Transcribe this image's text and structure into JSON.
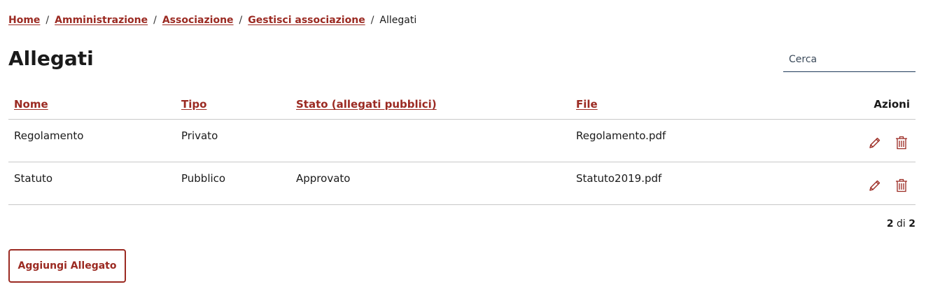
{
  "breadcrumb": {
    "items": [
      "Home",
      "Amministrazione",
      "Associazione",
      "Gestisci associazione"
    ],
    "separator": "/",
    "current": "Allegati"
  },
  "page": {
    "title": "Allegati"
  },
  "search": {
    "placeholder": "Cerca",
    "value": ""
  },
  "table": {
    "headers": {
      "nome": "Nome",
      "tipo": "Tipo",
      "stato": "Stato (allegati pubblici)",
      "file": "File",
      "azioni": "Azioni"
    },
    "rows": [
      {
        "nome": "Regolamento",
        "tipo": "Privato",
        "stato": "",
        "file": "Regolamento.pdf"
      },
      {
        "nome": "Statuto",
        "tipo": "Pubblico",
        "stato": "Approvato",
        "file": "Statuto2019.pdf"
      }
    ]
  },
  "pagination": {
    "current": "2",
    "sep": "di",
    "total": "2"
  },
  "actions": {
    "add_label": "Aggiungi Allegato"
  },
  "icons": {
    "edit": "pencil-icon",
    "delete": "trash-icon"
  },
  "colors": {
    "accent": "#9b2a22",
    "text": "#1a1a1a",
    "divider": "#c8c8c8",
    "search_underline": "#1f3a5a"
  }
}
